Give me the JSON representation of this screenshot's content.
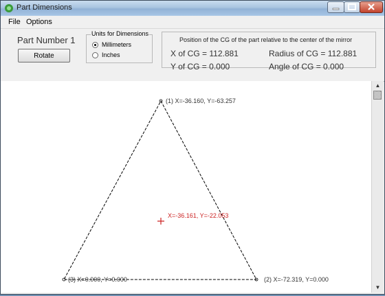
{
  "window": {
    "title": "Part Dimensions"
  },
  "menu": {
    "file": "File",
    "options": "Options"
  },
  "part": {
    "label": "Part Number 1",
    "rotate_label": "Rotate"
  },
  "units": {
    "legend": "Units for Dimensions",
    "options": [
      {
        "label": "Millimeters",
        "selected": true
      },
      {
        "label": "Inches",
        "selected": false
      }
    ]
  },
  "cg": {
    "title": "Position of the CG of the part relative to the center of the mirror",
    "x_text": "X of CG = 112.881",
    "y_text": "Y of CG = 0.000",
    "radius_text": "Radius of CG = 112.881",
    "angle_text": "Angle of CG = 0.000"
  },
  "drawing": {
    "vertices": [
      {
        "label": "(1) X=-36.160, Y=-63.257"
      },
      {
        "label": "(2) X=-72.319, Y=0.000"
      },
      {
        "label": "(3) X=0.000, Y=0.000"
      }
    ],
    "cg_label": "X=-36.161, Y=-22.053",
    "cg_color": "#cc2222",
    "line_color": "#000000"
  },
  "colors": {
    "titlebar": "#a9c4e0",
    "close": "#c2432c"
  }
}
